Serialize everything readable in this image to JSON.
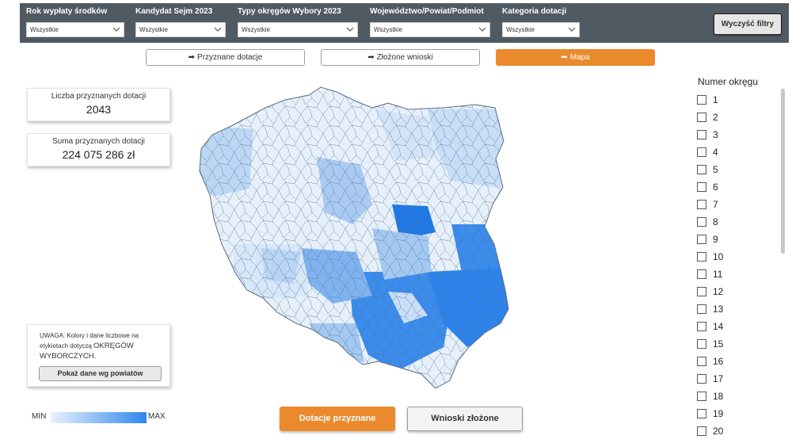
{
  "filters": [
    {
      "label": "Rok wypłaty środków",
      "value": "Wszystkie"
    },
    {
      "label": "Kandydat Sejm 2023",
      "value": "Wszystkie"
    },
    {
      "label": "Typy okręgów Wybory 2023",
      "value": "Wszystkie"
    },
    {
      "label": "Województwo/Powiat/Podmiot",
      "value": "Wszystkie"
    },
    {
      "label": "Kategoria dotacji",
      "value": "Wszystkie"
    }
  ],
  "clear_filters": "Wyczyść filtry",
  "nav": {
    "arrow": "➡",
    "granted": "Przyznane dotacje",
    "submitted": "Złożone wnioski",
    "map": "Mapa"
  },
  "kpi": {
    "count_label": "Liczba przyznanych dotacji",
    "count_value": "2043",
    "sum_label": "Suma przyznanych dotacji",
    "sum_value": "224 075 286 zł"
  },
  "note": {
    "text_small_1": "UWAGA: Kolory i dane liczbowe na",
    "text_small_2": "etykietach dotyczą",
    "text_big": "OKRĘGÓW WYBORCZYCH.",
    "button": "Pokaż dane wg powiatów"
  },
  "legend": {
    "min": "MIN",
    "max": "MAX",
    "color_min": "#e8f2fd",
    "color_max": "#2f86ec"
  },
  "bottom": {
    "granted": "Dotacje przyznane",
    "submitted": "Wnioski złożone"
  },
  "slicer": {
    "title": "Numer okręgu",
    "items": [
      "1",
      "2",
      "3",
      "4",
      "5",
      "6",
      "7",
      "8",
      "9",
      "10",
      "11",
      "12",
      "13",
      "14",
      "15",
      "16",
      "17",
      "18",
      "19",
      "20"
    ]
  },
  "colors": {
    "accent": "#ea8a2c",
    "header": "#505a62"
  }
}
